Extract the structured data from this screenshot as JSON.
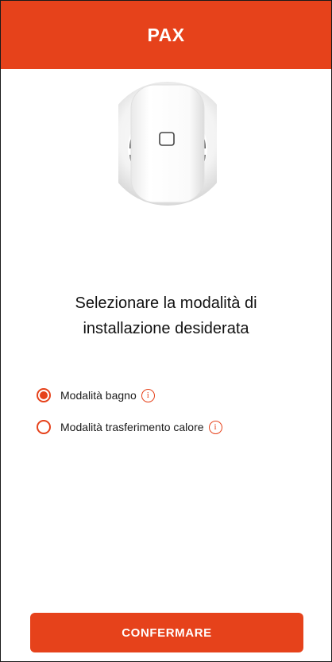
{
  "header": {
    "logo": "PAX"
  },
  "product": {
    "image_name": "pax-fan-unit"
  },
  "title": {
    "line1": "Selezionare la modalità di",
    "line2": "installazione desiderata"
  },
  "options": [
    {
      "label": "Modalità bagno",
      "selected": true,
      "info_glyph": "i"
    },
    {
      "label": "Modalità trasferimento calore",
      "selected": false,
      "info_glyph": "i"
    }
  ],
  "confirm_button": {
    "label": "CONFERMARE"
  },
  "colors": {
    "accent": "#e6421b",
    "text": "#111111",
    "background": "#ffffff"
  }
}
